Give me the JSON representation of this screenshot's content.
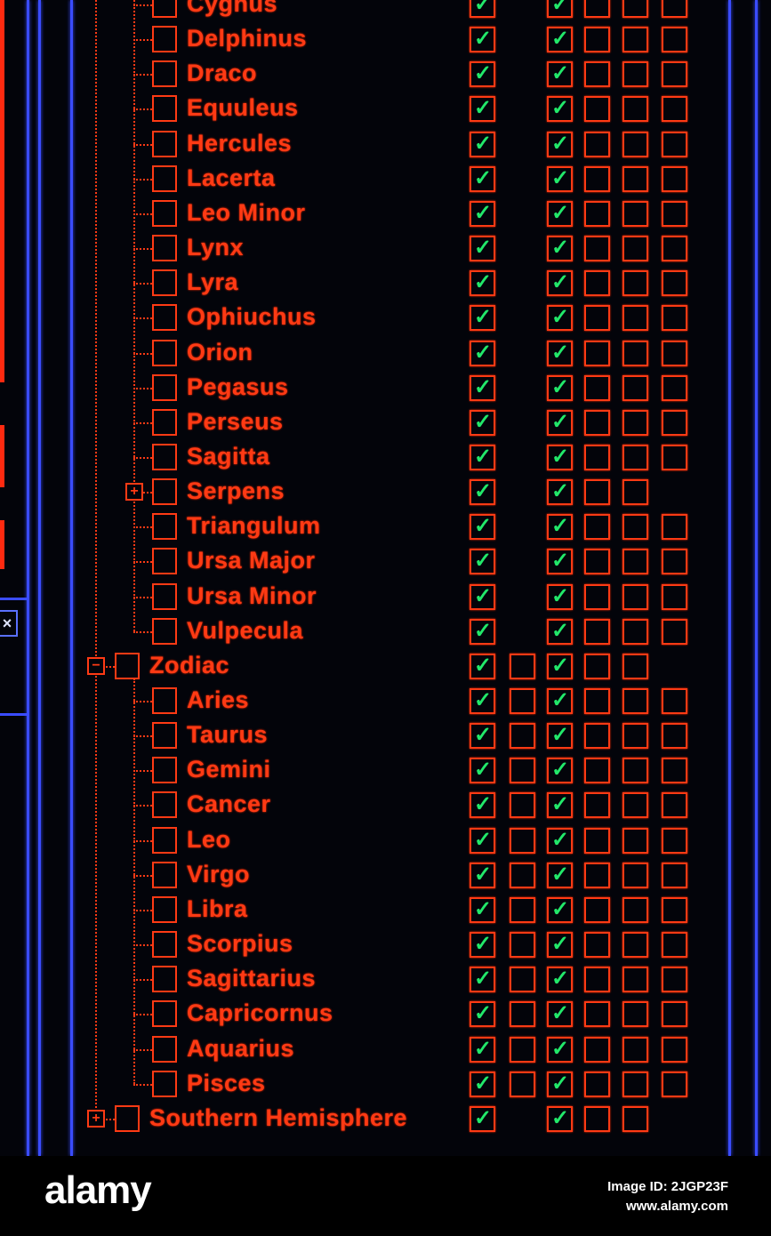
{
  "colors": {
    "text": "#ff3a14",
    "check": "#22e86a",
    "frame": "#3a4cff",
    "background": "#03040a"
  },
  "left_panel": {
    "close_label": "×"
  },
  "tree": {
    "rows": [
      {
        "label": "Cygnus",
        "level": "child",
        "expander": null,
        "cols": [
          "checked",
          null,
          "checked",
          "empty",
          "empty",
          "empty"
        ]
      },
      {
        "label": "Delphinus",
        "level": "child",
        "expander": null,
        "cols": [
          "checked",
          null,
          "checked",
          "empty",
          "empty",
          "empty"
        ]
      },
      {
        "label": "Draco",
        "level": "child",
        "expander": null,
        "cols": [
          "checked",
          null,
          "checked",
          "empty",
          "empty",
          "empty"
        ]
      },
      {
        "label": "Equuleus",
        "level": "child",
        "expander": null,
        "cols": [
          "checked",
          null,
          "checked",
          "empty",
          "empty",
          "empty"
        ]
      },
      {
        "label": "Hercules",
        "level": "child",
        "expander": null,
        "cols": [
          "checked",
          null,
          "checked",
          "empty",
          "empty",
          "empty"
        ]
      },
      {
        "label": "Lacerta",
        "level": "child",
        "expander": null,
        "cols": [
          "checked",
          null,
          "checked",
          "empty",
          "empty",
          "empty"
        ]
      },
      {
        "label": "Leo Minor",
        "level": "child",
        "expander": null,
        "cols": [
          "checked",
          null,
          "checked",
          "empty",
          "empty",
          "empty"
        ]
      },
      {
        "label": "Lynx",
        "level": "child",
        "expander": null,
        "cols": [
          "checked",
          null,
          "checked",
          "empty",
          "empty",
          "empty"
        ]
      },
      {
        "label": "Lyra",
        "level": "child",
        "expander": null,
        "cols": [
          "checked",
          null,
          "checked",
          "empty",
          "empty",
          "empty"
        ]
      },
      {
        "label": "Ophiuchus",
        "level": "child",
        "expander": null,
        "cols": [
          "checked",
          null,
          "checked",
          "empty",
          "empty",
          "empty"
        ]
      },
      {
        "label": "Orion",
        "level": "child",
        "expander": null,
        "cols": [
          "checked",
          null,
          "checked",
          "empty",
          "empty",
          "empty"
        ]
      },
      {
        "label": "Pegasus",
        "level": "child",
        "expander": null,
        "cols": [
          "checked",
          null,
          "checked",
          "empty",
          "empty",
          "empty"
        ]
      },
      {
        "label": "Perseus",
        "level": "child",
        "expander": null,
        "cols": [
          "checked",
          null,
          "checked",
          "empty",
          "empty",
          "empty"
        ]
      },
      {
        "label": "Sagitta",
        "level": "child",
        "expander": null,
        "cols": [
          "checked",
          null,
          "checked",
          "empty",
          "empty",
          "empty"
        ]
      },
      {
        "label": "Serpens",
        "level": "child",
        "expander": "+",
        "cols": [
          "checked",
          null,
          "checked",
          "empty",
          "empty",
          null
        ]
      },
      {
        "label": "Triangulum",
        "level": "child",
        "expander": null,
        "cols": [
          "checked",
          null,
          "checked",
          "empty",
          "empty",
          "empty"
        ]
      },
      {
        "label": "Ursa Major",
        "level": "child",
        "expander": null,
        "cols": [
          "checked",
          null,
          "checked",
          "empty",
          "empty",
          "empty"
        ]
      },
      {
        "label": "Ursa Minor",
        "level": "child",
        "expander": null,
        "cols": [
          "checked",
          null,
          "checked",
          "empty",
          "empty",
          "empty"
        ]
      },
      {
        "label": "Vulpecula",
        "level": "child",
        "expander": null,
        "cols": [
          "checked",
          null,
          "checked",
          "empty",
          "empty",
          "empty"
        ]
      },
      {
        "label": "Zodiac",
        "level": "group",
        "expander": "-",
        "cols": [
          "checked",
          "empty",
          "checked",
          "empty",
          "empty",
          null
        ]
      },
      {
        "label": "Aries",
        "level": "child",
        "expander": null,
        "cols": [
          "checked",
          "empty",
          "checked",
          "empty",
          "empty",
          "empty"
        ]
      },
      {
        "label": "Taurus",
        "level": "child",
        "expander": null,
        "cols": [
          "checked",
          "empty",
          "checked",
          "empty",
          "empty",
          "empty"
        ]
      },
      {
        "label": "Gemini",
        "level": "child",
        "expander": null,
        "cols": [
          "checked",
          "empty",
          "checked",
          "empty",
          "empty",
          "empty"
        ]
      },
      {
        "label": "Cancer",
        "level": "child",
        "expander": null,
        "cols": [
          "checked",
          "empty",
          "checked",
          "empty",
          "empty",
          "empty"
        ]
      },
      {
        "label": "Leo",
        "level": "child",
        "expander": null,
        "cols": [
          "checked",
          "empty",
          "checked",
          "empty",
          "empty",
          "empty"
        ]
      },
      {
        "label": "Virgo",
        "level": "child",
        "expander": null,
        "cols": [
          "checked",
          "empty",
          "checked",
          "empty",
          "empty",
          "empty"
        ]
      },
      {
        "label": "Libra",
        "level": "child",
        "expander": null,
        "cols": [
          "checked",
          "empty",
          "checked",
          "empty",
          "empty",
          "empty"
        ]
      },
      {
        "label": "Scorpius",
        "level": "child",
        "expander": null,
        "cols": [
          "checked",
          "empty",
          "checked",
          "empty",
          "empty",
          "empty"
        ]
      },
      {
        "label": "Sagittarius",
        "level": "child",
        "expander": null,
        "cols": [
          "checked",
          "empty",
          "checked",
          "empty",
          "empty",
          "empty"
        ]
      },
      {
        "label": "Capricornus",
        "level": "child",
        "expander": null,
        "cols": [
          "checked",
          "empty",
          "checked",
          "empty",
          "empty",
          "empty"
        ]
      },
      {
        "label": "Aquarius",
        "level": "child",
        "expander": null,
        "cols": [
          "checked",
          "empty",
          "checked",
          "empty",
          "empty",
          "empty"
        ]
      },
      {
        "label": "Pisces",
        "level": "child",
        "expander": null,
        "cols": [
          "checked",
          "empty",
          "checked",
          "empty",
          "empty",
          "empty"
        ]
      },
      {
        "label": "Southern Hemisphere",
        "level": "group",
        "expander": "+",
        "cols": [
          "checked",
          null,
          "checked",
          "empty",
          "empty",
          null
        ]
      }
    ]
  },
  "watermark": {
    "logo": "alamy",
    "image_id": "Image ID: 2JGP23F",
    "url": "www.alamy.com"
  }
}
